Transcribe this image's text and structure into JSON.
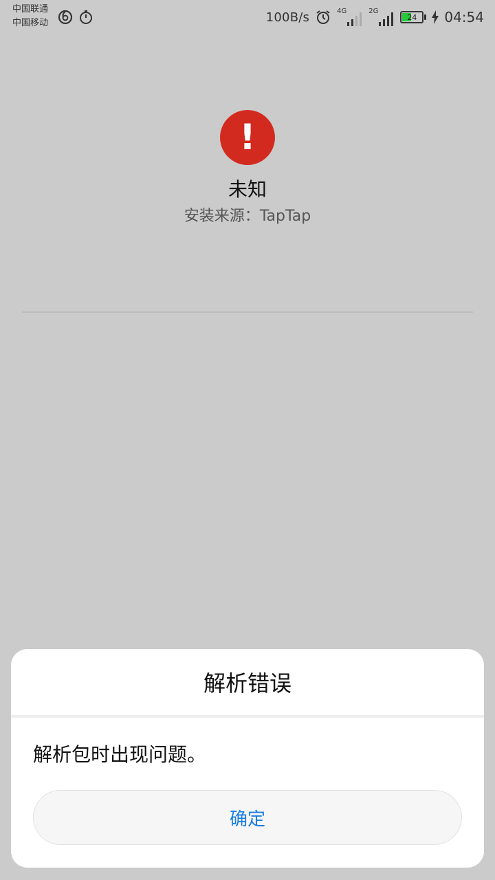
{
  "status_bar": {
    "carrier_1": "中国联通",
    "carrier_2": "中国移动",
    "net_speed": "100B/s",
    "sim1_network": "4G",
    "sim2_network": "2G",
    "battery_level": "24",
    "time": "04:54",
    "icons": [
      "netease-cloud-music-icon",
      "stopwatch-icon",
      "alarm-icon",
      "signal-icon",
      "battery-icon",
      "charging-icon"
    ]
  },
  "app_info": {
    "error_glyph": "!",
    "name": "未知",
    "install_source": "安装来源：TapTap"
  },
  "dialog": {
    "title": "解析错误",
    "message": "解析包时出现问题。",
    "confirm_label": "确定"
  },
  "colors": {
    "background": "#cbcbcb",
    "error_red": "#d32a1f",
    "accent_blue": "#1a7de0",
    "battery_green": "#28c83b"
  }
}
